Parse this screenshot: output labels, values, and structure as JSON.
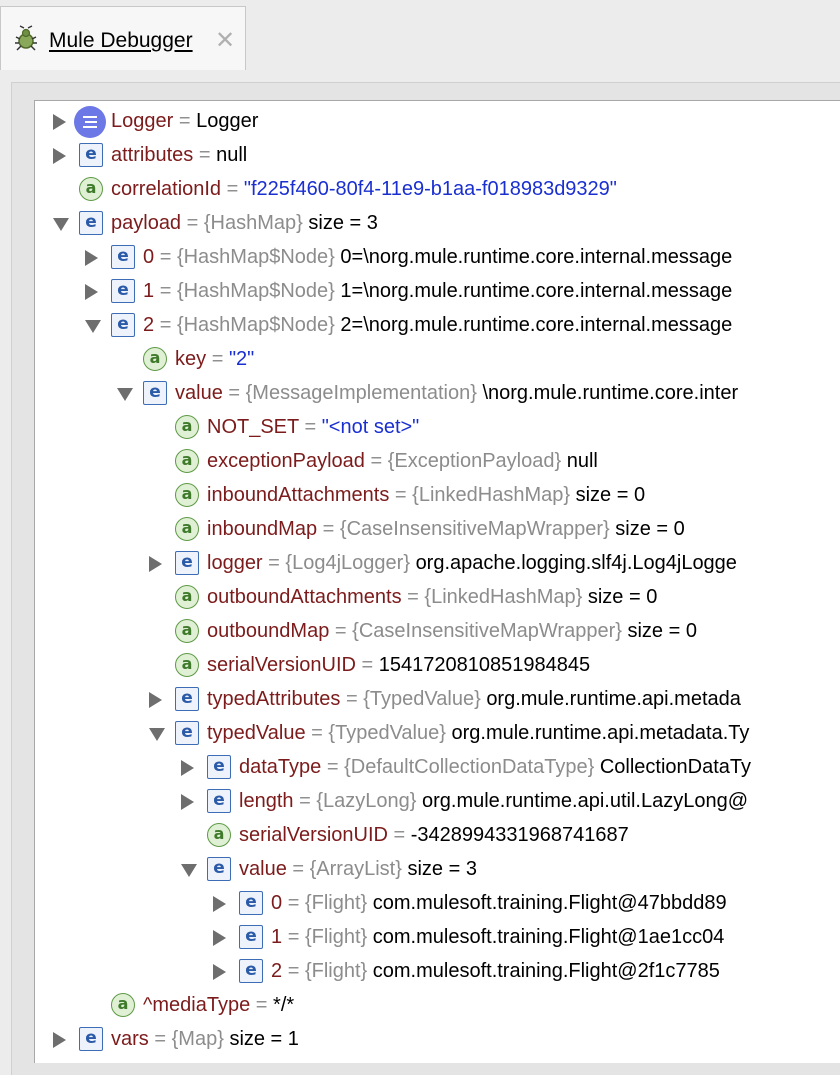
{
  "tab": {
    "title": "Mule Debugger",
    "close": "✕",
    "icon": "debugger-bug-icon"
  },
  "rows": [
    {
      "icon": "logger",
      "expander": "collapsed",
      "name": "Logger",
      "eq": "=",
      "type": "",
      "value": "Logger",
      "string": false
    },
    {
      "icon": "e",
      "expander": "collapsed",
      "name": "attributes",
      "eq": "=",
      "type": "",
      "value": "null",
      "string": false
    },
    {
      "icon": "a",
      "expander": "none",
      "name": "correlationId",
      "eq": "=",
      "type": "",
      "value": "\"f225f460-80f4-11e9-b1aa-f018983d9329\"",
      "string": true
    },
    {
      "icon": "e",
      "expander": "expanded",
      "name": "payload",
      "eq": "=",
      "type": "{HashMap}",
      "value": "size = 3",
      "string": false
    },
    {
      "icon": "e",
      "expander": "collapsed",
      "name": "0",
      "eq": "=",
      "type": "{HashMap$Node}",
      "value": "0=\\norg.mule.runtime.core.internal.message",
      "string": false
    },
    {
      "icon": "e",
      "expander": "collapsed",
      "name": "1",
      "eq": "=",
      "type": "{HashMap$Node}",
      "value": "1=\\norg.mule.runtime.core.internal.message",
      "string": false
    },
    {
      "icon": "e",
      "expander": "expanded",
      "name": "2",
      "eq": "=",
      "type": "{HashMap$Node}",
      "value": "2=\\norg.mule.runtime.core.internal.message",
      "string": false
    },
    {
      "icon": "a",
      "expander": "none",
      "name": "key",
      "eq": "=",
      "type": "",
      "value": "\"2\"",
      "string": true
    },
    {
      "icon": "e",
      "expander": "expanded",
      "name": "value",
      "eq": "=",
      "type": "{MessageImplementation}",
      "value": "\\norg.mule.runtime.core.inter",
      "string": false
    },
    {
      "icon": "a",
      "expander": "none",
      "name": "NOT_SET",
      "eq": "=",
      "type": "",
      "value": "\"<not set>\"",
      "string": true
    },
    {
      "icon": "a",
      "expander": "none",
      "name": "exceptionPayload",
      "eq": "=",
      "type": "{ExceptionPayload}",
      "value": "null",
      "string": false
    },
    {
      "icon": "a",
      "expander": "none",
      "name": "inboundAttachments",
      "eq": "=",
      "type": "{LinkedHashMap}",
      "value": "size = 0",
      "string": false
    },
    {
      "icon": "a",
      "expander": "none",
      "name": "inboundMap",
      "eq": "=",
      "type": "{CaseInsensitiveMapWrapper}",
      "value": "size = 0",
      "string": false
    },
    {
      "icon": "e",
      "expander": "collapsed",
      "name": "logger",
      "eq": "=",
      "type": "{Log4jLogger}",
      "value": "org.apache.logging.slf4j.Log4jLogge",
      "string": false
    },
    {
      "icon": "a",
      "expander": "none",
      "name": "outboundAttachments",
      "eq": "=",
      "type": "{LinkedHashMap}",
      "value": "size = 0",
      "string": false
    },
    {
      "icon": "a",
      "expander": "none",
      "name": "outboundMap",
      "eq": "=",
      "type": "{CaseInsensitiveMapWrapper}",
      "value": "size = 0",
      "string": false
    },
    {
      "icon": "a",
      "expander": "none",
      "name": "serialVersionUID",
      "eq": "=",
      "type": "",
      "value": "1541720810851984845",
      "string": false
    },
    {
      "icon": "e",
      "expander": "collapsed",
      "name": "typedAttributes",
      "eq": "=",
      "type": "{TypedValue}",
      "value": "org.mule.runtime.api.metada",
      "string": false
    },
    {
      "icon": "e",
      "expander": "expanded",
      "name": "typedValue",
      "eq": "=",
      "type": "{TypedValue}",
      "value": "org.mule.runtime.api.metadata.Ty",
      "string": false
    },
    {
      "icon": "e",
      "expander": "collapsed",
      "name": "dataType",
      "eq": "=",
      "type": "{DefaultCollectionDataType}",
      "value": "CollectionDataTy",
      "string": false
    },
    {
      "icon": "e",
      "expander": "collapsed",
      "name": "length",
      "eq": "=",
      "type": "{LazyLong}",
      "value": "org.mule.runtime.api.util.LazyLong@",
      "string": false
    },
    {
      "icon": "a",
      "expander": "none",
      "name": "serialVersionUID",
      "eq": "=",
      "type": "",
      "value": "-3428994331968741687",
      "string": false
    },
    {
      "icon": "e",
      "expander": "expanded",
      "name": "value",
      "eq": "=",
      "type": "{ArrayList}",
      "value": "size = 3",
      "string": false
    },
    {
      "icon": "e",
      "expander": "collapsed",
      "name": "0",
      "eq": "=",
      "type": "{Flight}",
      "value": "com.mulesoft.training.Flight@47bbdd89",
      "string": false
    },
    {
      "icon": "e",
      "expander": "collapsed",
      "name": "1",
      "eq": "=",
      "type": "{Flight}",
      "value": "com.mulesoft.training.Flight@1ae1cc04",
      "string": false
    },
    {
      "icon": "e",
      "expander": "collapsed",
      "name": "2",
      "eq": "=",
      "type": "{Flight}",
      "value": "com.mulesoft.training.Flight@2f1c7785",
      "string": false
    },
    {
      "icon": "a",
      "expander": "none",
      "name": "^mediaType",
      "eq": "=",
      "type": "",
      "value": "*/*",
      "string": false
    },
    {
      "icon": "e",
      "expander": "collapsed",
      "name": "vars",
      "eq": "=",
      "type": "{Map}",
      "value": "size = 1",
      "string": false
    }
  ]
}
